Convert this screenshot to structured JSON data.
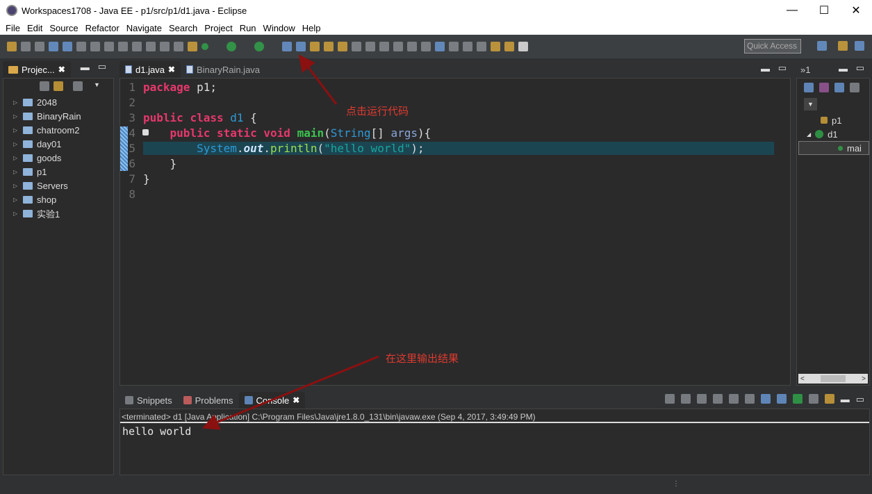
{
  "window": {
    "title": "Workspaces1708 - Java EE - p1/src/p1/d1.java - Eclipse",
    "minimize": "—",
    "maximize": "☐",
    "close": "✕"
  },
  "menu": [
    "File",
    "Edit",
    "Source",
    "Refactor",
    "Navigate",
    "Search",
    "Project",
    "Run",
    "Window",
    "Help"
  ],
  "toolbar": {
    "quick_access": "Quick Access"
  },
  "project_explorer": {
    "title": "Projec...",
    "items": [
      "2048",
      "BinaryRain",
      "chatroom2",
      "day01",
      "goods",
      "p1",
      "Servers",
      "shop",
      "实验1"
    ]
  },
  "editor": {
    "tabs": [
      {
        "label": "d1.java",
        "active": true
      },
      {
        "label": "BinaryRain.java",
        "active": false
      }
    ],
    "line_numbers": [
      "1",
      "2",
      "3",
      "4",
      "5",
      "6",
      "7",
      "8"
    ]
  },
  "outline": {
    "tab": "»1",
    "items": [
      "p1",
      "d1",
      "mai"
    ]
  },
  "bottom": {
    "tabs": [
      "Snippets",
      "Problems",
      "Console"
    ],
    "status": "<terminated> d1 [Java Application] C:\\Program Files\\Java\\jre1.8.0_131\\bin\\javaw.exe (Sep 4, 2017, 3:49:49 PM)",
    "output": "hello world"
  },
  "annotations": {
    "run": "点击运行代码",
    "output": "在这里输出结果"
  },
  "colors": {
    "annotation": "#e03a2e",
    "arrow": "#8b1010",
    "keyword": "#e6386b",
    "string": "#17a69e"
  }
}
